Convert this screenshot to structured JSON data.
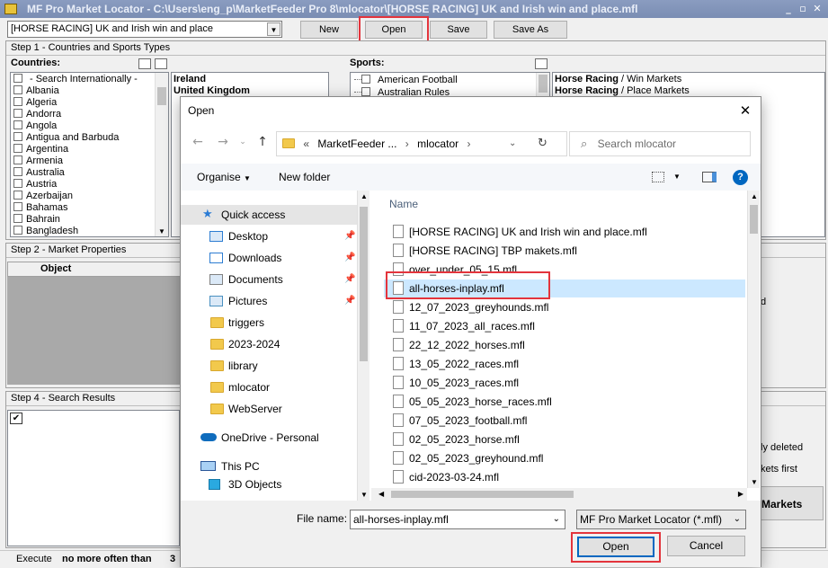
{
  "app": {
    "title": "MF Pro Market Locator - C:\\Users\\eng_p\\MarketFeeder Pro 8\\mlocator\\[HORSE RACING] UK and Irish win and place.mfl",
    "window_controls": {
      "minimize": "_",
      "maximize": "▫",
      "close": "✕"
    }
  },
  "toolbar": {
    "file_combo": "[HORSE RACING] UK and Irish win and place",
    "new_label": "New",
    "open_label": "Open",
    "save_label": "Save",
    "saveas_label": "Save As"
  },
  "step1": {
    "header": "Step 1 - Countries and Sports Types",
    "countries_label": "Countries:",
    "countries": [
      "- Search Internationally -",
      "Albania",
      "Algeria",
      "Andorra",
      "Angola",
      "Antigua and Barbuda",
      "Argentina",
      "Armenia",
      "Australia",
      "Austria",
      "Azerbaijan",
      "Bahamas",
      "Bahrain",
      "Bangladesh"
    ],
    "selected_countries": [
      "Ireland",
      "United Kingdom"
    ],
    "sports_label": "Sports:",
    "sports": [
      "American Football",
      "Australian Rules"
    ],
    "selected_markets": [
      {
        "sport": "Horse Racing",
        "market": "Win Markets"
      },
      {
        "sport": "Horse Racing",
        "market": "Place Markets"
      }
    ]
  },
  "step2": {
    "header": "Step 2 - Market Properties",
    "column_object": "Object"
  },
  "step4": {
    "header": "Step 4 - Search Results"
  },
  "background_fragments": {
    "right_a": "d",
    "right_b": "ly deleted",
    "right_c": "kets first",
    "markets_btn": "Markets"
  },
  "statusbar": {
    "execute": "Execute",
    "often": "no more often than",
    "value": "3"
  },
  "dialog": {
    "title": "Open",
    "close": "✕",
    "address": {
      "prefix": "«",
      "parts": [
        "MarketFeeder ...",
        "mlocator"
      ],
      "separator": "›"
    },
    "search_placeholder": "Search mlocator",
    "organise_label": "Organise",
    "new_folder_label": "New folder",
    "nav": {
      "quick_access": "Quick access",
      "pinned": [
        {
          "name": "Desktop",
          "icon": "desktop-icon"
        },
        {
          "name": "Downloads",
          "icon": "downloads-icon"
        },
        {
          "name": "Documents",
          "icon": "documents-icon"
        },
        {
          "name": "Pictures",
          "icon": "pictures-icon"
        }
      ],
      "folders": [
        "triggers",
        "2023-2024",
        "library",
        "mlocator",
        "WebServer"
      ],
      "onedrive": "OneDrive - Personal",
      "this_pc": "This PC",
      "objects_3d": "3D Objects"
    },
    "column_name": "Name",
    "files": [
      "[HORSE RACING] UK and Irish win and place.mfl",
      "[HORSE RACING] TBP makets.mfl",
      "over_under_05_15.mfl",
      "all-horses-inplay.mfl",
      "12_07_2023_greyhounds.mfl",
      "11_07_2023_all_races.mfl",
      "22_12_2022_horses.mfl",
      "13_05_2022_races.mfl",
      "10_05_2023_races.mfl",
      "05_05_2023_horse_races.mfl",
      "07_05_2023_football.mfl",
      "02_05_2023_horse.mfl",
      "02_05_2023_greyhound.mfl",
      "cid-2023-03-24.mfl"
    ],
    "selected_file": "all-horses-inplay.mfl",
    "filename_label": "File name:",
    "filename_value": "all-horses-inplay.mfl",
    "filetype": "MF Pro Market Locator (*.mfl)",
    "open_label": "Open",
    "cancel_label": "Cancel"
  },
  "colors": {
    "highlight_box": "#e3343c",
    "selection": "#cce8ff",
    "accent_blue": "#0067c0"
  }
}
